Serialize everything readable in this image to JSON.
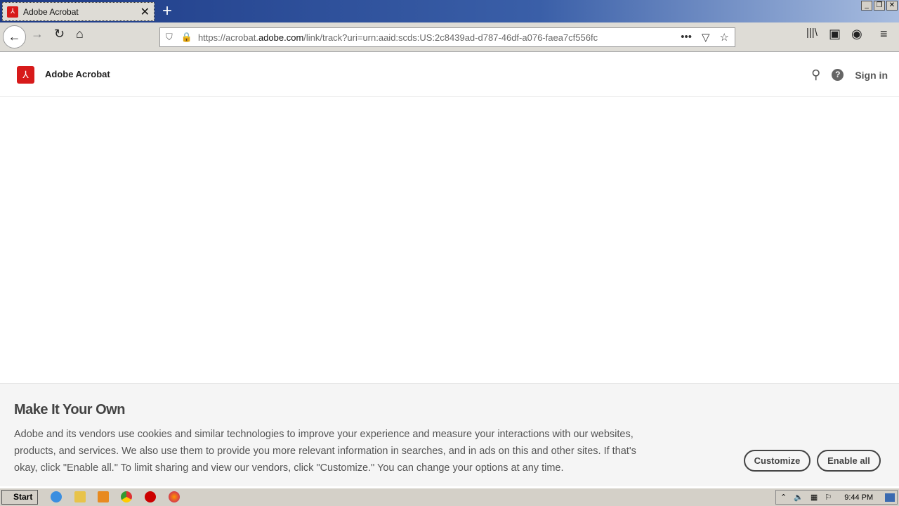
{
  "browser": {
    "tab_title": "Adobe Acrobat",
    "url_prefix": "https://acrobat.",
    "url_domain": "adobe.com",
    "url_path": "/link/track?uri=urn:aaid:scds:US:2c8439ad-d787-46df-a076-faea7cf556fc"
  },
  "header": {
    "brand": "Adobe Acrobat",
    "sign_in": "Sign in"
  },
  "banner": {
    "title": "Make It Your Own",
    "text": "Adobe and its vendors use cookies and similar technologies to improve your experience and measure your interactions with our websites, products, and services. We also use them to provide you more relevant information in searches, and in ads on this and other sites. If that's okay, click \"Enable all.\" To limit sharing and view our vendors, click \"Customize.\" You can change your options at any time.",
    "customize": "Customize",
    "enable_all": "Enable all"
  },
  "taskbar": {
    "start": "Start",
    "clock": "9:44 PM"
  },
  "colors": {
    "brand_red": "#d71a1a"
  }
}
